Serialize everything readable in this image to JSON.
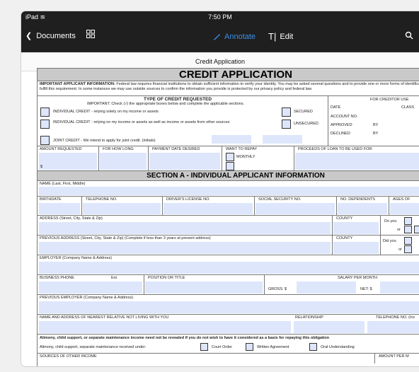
{
  "status": {
    "device": "iPad",
    "time": "7:50 PM"
  },
  "toolbar": {
    "back_label": "Documents",
    "annotate_label": "Annotate",
    "edit_label": "Edit"
  },
  "doc_title": "Credit Application",
  "form": {
    "title": "CREDIT APPLICATION",
    "info_bold": "IMPORTANT APPLICANT INFORMATION:",
    "info_text": "Federal law requires financial institutions to obtain sufficient information to verify your identity. You may be asked several questions and to provide one or more forms of identification to fulfill this requirement. In some instances we may use outside sources to confirm the information you provide is protected by our privacy policy and federal law.",
    "type_header": "TYPE OF CREDIT REQUESTED",
    "type_note": "IMPORTANT: Check (√) the appropriate boxes below and complete the applicable sections.",
    "individual_1": "INDIVIDUAL CREDIT - relying solely on my income or assets",
    "individual_2": "INDIVIDUAL CREDIT - relying on my income or assets as well as income or assets from other sources",
    "secured": "SECURED",
    "unsecured": "UNSECURED",
    "joint": "JOINT CREDIT - We intend to apply for joint credit. (initials)",
    "creditor_use": "FOR CREDITOR USE",
    "date": "DATE",
    "class": "CLASS",
    "account_no": "ACCOUNT NO.",
    "approved": "APPROVED",
    "declined": "DECLINED",
    "by": "BY",
    "amount_requested": "AMOUNT REQUESTED",
    "how_long": "FOR HOW LONG",
    "payment_date": "PAYMENT DATE DESIRED",
    "want_repay": "WANT TO REPAY",
    "monthly": "MONTHLY",
    "proceeds": "PROCEEDS OF LOAN TO BE USED FOR:",
    "dollar": "$",
    "section_a": "SECTION A - INDIVIDUAL APPLICANT INFORMATION",
    "name": "NAME (Last, First, Middle)",
    "birthdate": "BIRTHDATE",
    "telephone": "TELEPHONE NO.",
    "license": "DRIVER'S LICENSE NO.",
    "ssn": "SOCIAL SECURITY NO.",
    "dependents": "NO. DEPENDENTS",
    "ages": "AGES OF",
    "address": "ADDRESS (Street, City, State & Zip)",
    "county": "COUNTY",
    "do_you": "Do you",
    "or": "or",
    "prev_address": "PREVIOUS ADDRESS (Street, City, State & Zip) (Complete if less than 3 years at present address)",
    "did_you": "Did you",
    "employer": "EMPLOYER (Company Name & Address)",
    "business_phone": "BUSINESS PHONE",
    "ext": "Ext.",
    "position": "POSITION OR TITLE",
    "salary": "SALARY PER MONTH",
    "gross": "GROSS: $",
    "net": "NET: $",
    "prev_employer": "PREVIOUS EMPLOYER (Company Name & Address)",
    "nearest_relative": "NAME AND ADDRESS OF NEAREST RELATIVE NOT LIVING WITH YOU",
    "relationship": "RELATIONSHIP",
    "telephone_inc": "TELEPHONE NO. (Inc",
    "alimony_bold": "Alimony, child support, or separate maintenance income need not be revealed if you do not wish to have it considered as a basis for repaying this obligation",
    "alimony_text": "Alimony, child support, separate maintenance received under:",
    "court_order": "Court Order",
    "written_agreement": "Written Agreement",
    "oral": "Oral Understanding",
    "other_income": "SOURCES OF OTHER INCOME",
    "amount_per_month": "AMOUNT PER M"
  },
  "colors": {
    "accent": "#3a8ee6",
    "field": "#dde6fb",
    "header_bg": "#c9c9c9",
    "toolbar_bg": "#1f1f1f"
  }
}
